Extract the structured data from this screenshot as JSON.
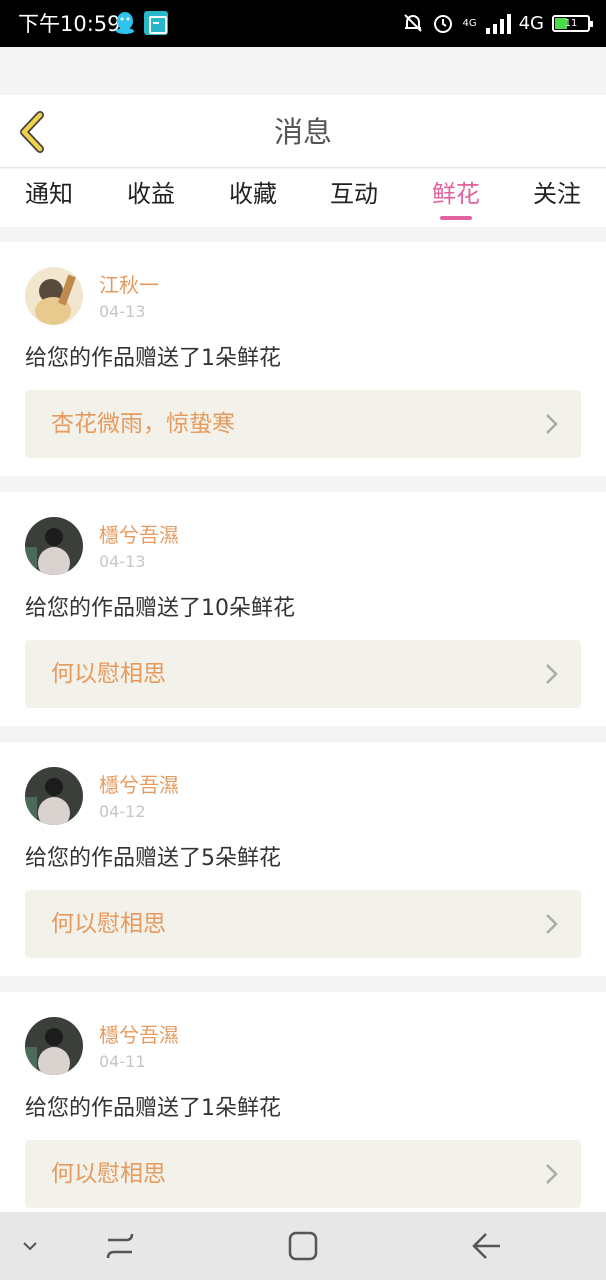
{
  "status_bar": {
    "time": "下午10:59",
    "network_small": "4G",
    "network": "4G",
    "battery": "11"
  },
  "header": {
    "title": "消息",
    "back_icon": "chevron-left-icon"
  },
  "tabs": [
    {
      "label": "通知",
      "active": false
    },
    {
      "label": "收益",
      "active": false
    },
    {
      "label": "收藏",
      "active": false
    },
    {
      "label": "互动",
      "active": false
    },
    {
      "label": "鲜花",
      "active": true
    },
    {
      "label": "关注",
      "active": false
    }
  ],
  "messages": [
    {
      "username": "江秋一",
      "date": "04-13",
      "text": "给您的作品赠送了1朵鲜花",
      "work_title": "杏花微雨，惊蛰寒"
    },
    {
      "username": "檼兮吾濕",
      "date": "04-13",
      "text": "给您的作品赠送了10朵鲜花",
      "work_title": "何以慰相思"
    },
    {
      "username": "檼兮吾濕",
      "date": "04-12",
      "text": "给您的作品赠送了5朵鲜花",
      "work_title": "何以慰相思"
    },
    {
      "username": "檼兮吾濕",
      "date": "04-11",
      "text": "给您的作品赠送了1朵鲜花",
      "work_title": "何以慰相思"
    }
  ],
  "colors": {
    "accent": "#e0639d",
    "username": "#e79a5e",
    "back_icon": "#f0d24a",
    "work_box_bg": "#f3f2ea"
  }
}
